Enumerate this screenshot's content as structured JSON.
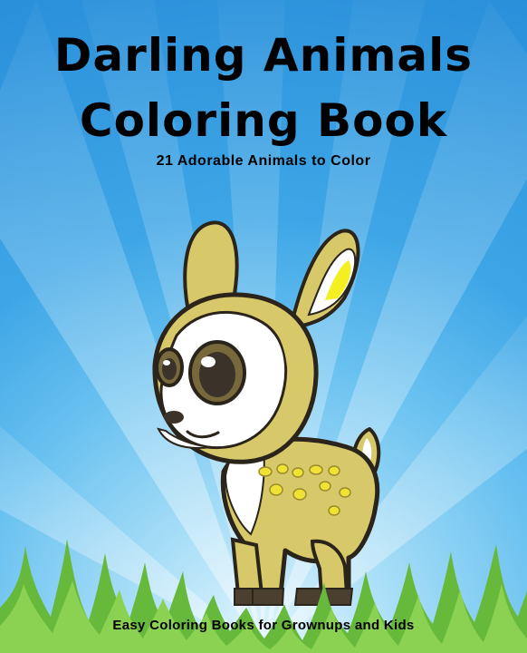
{
  "cover": {
    "title_line_1": "Darling Animals",
    "title_line_2": "Coloring Book",
    "subtitle": "21 Adorable Animals to Color",
    "footer": "Easy Coloring Books for Grownups and Kids"
  },
  "illustration": {
    "subject": "fawn",
    "background": "sky-blue sunburst with grass"
  },
  "colors": {
    "sky_dark": "#2a8fda",
    "sky_light": "#a8def7",
    "fawn_body": "#d7c86a",
    "fawn_outline": "#2a241b",
    "fawn_spots": "#f0e233",
    "grass": "#67b93b"
  }
}
